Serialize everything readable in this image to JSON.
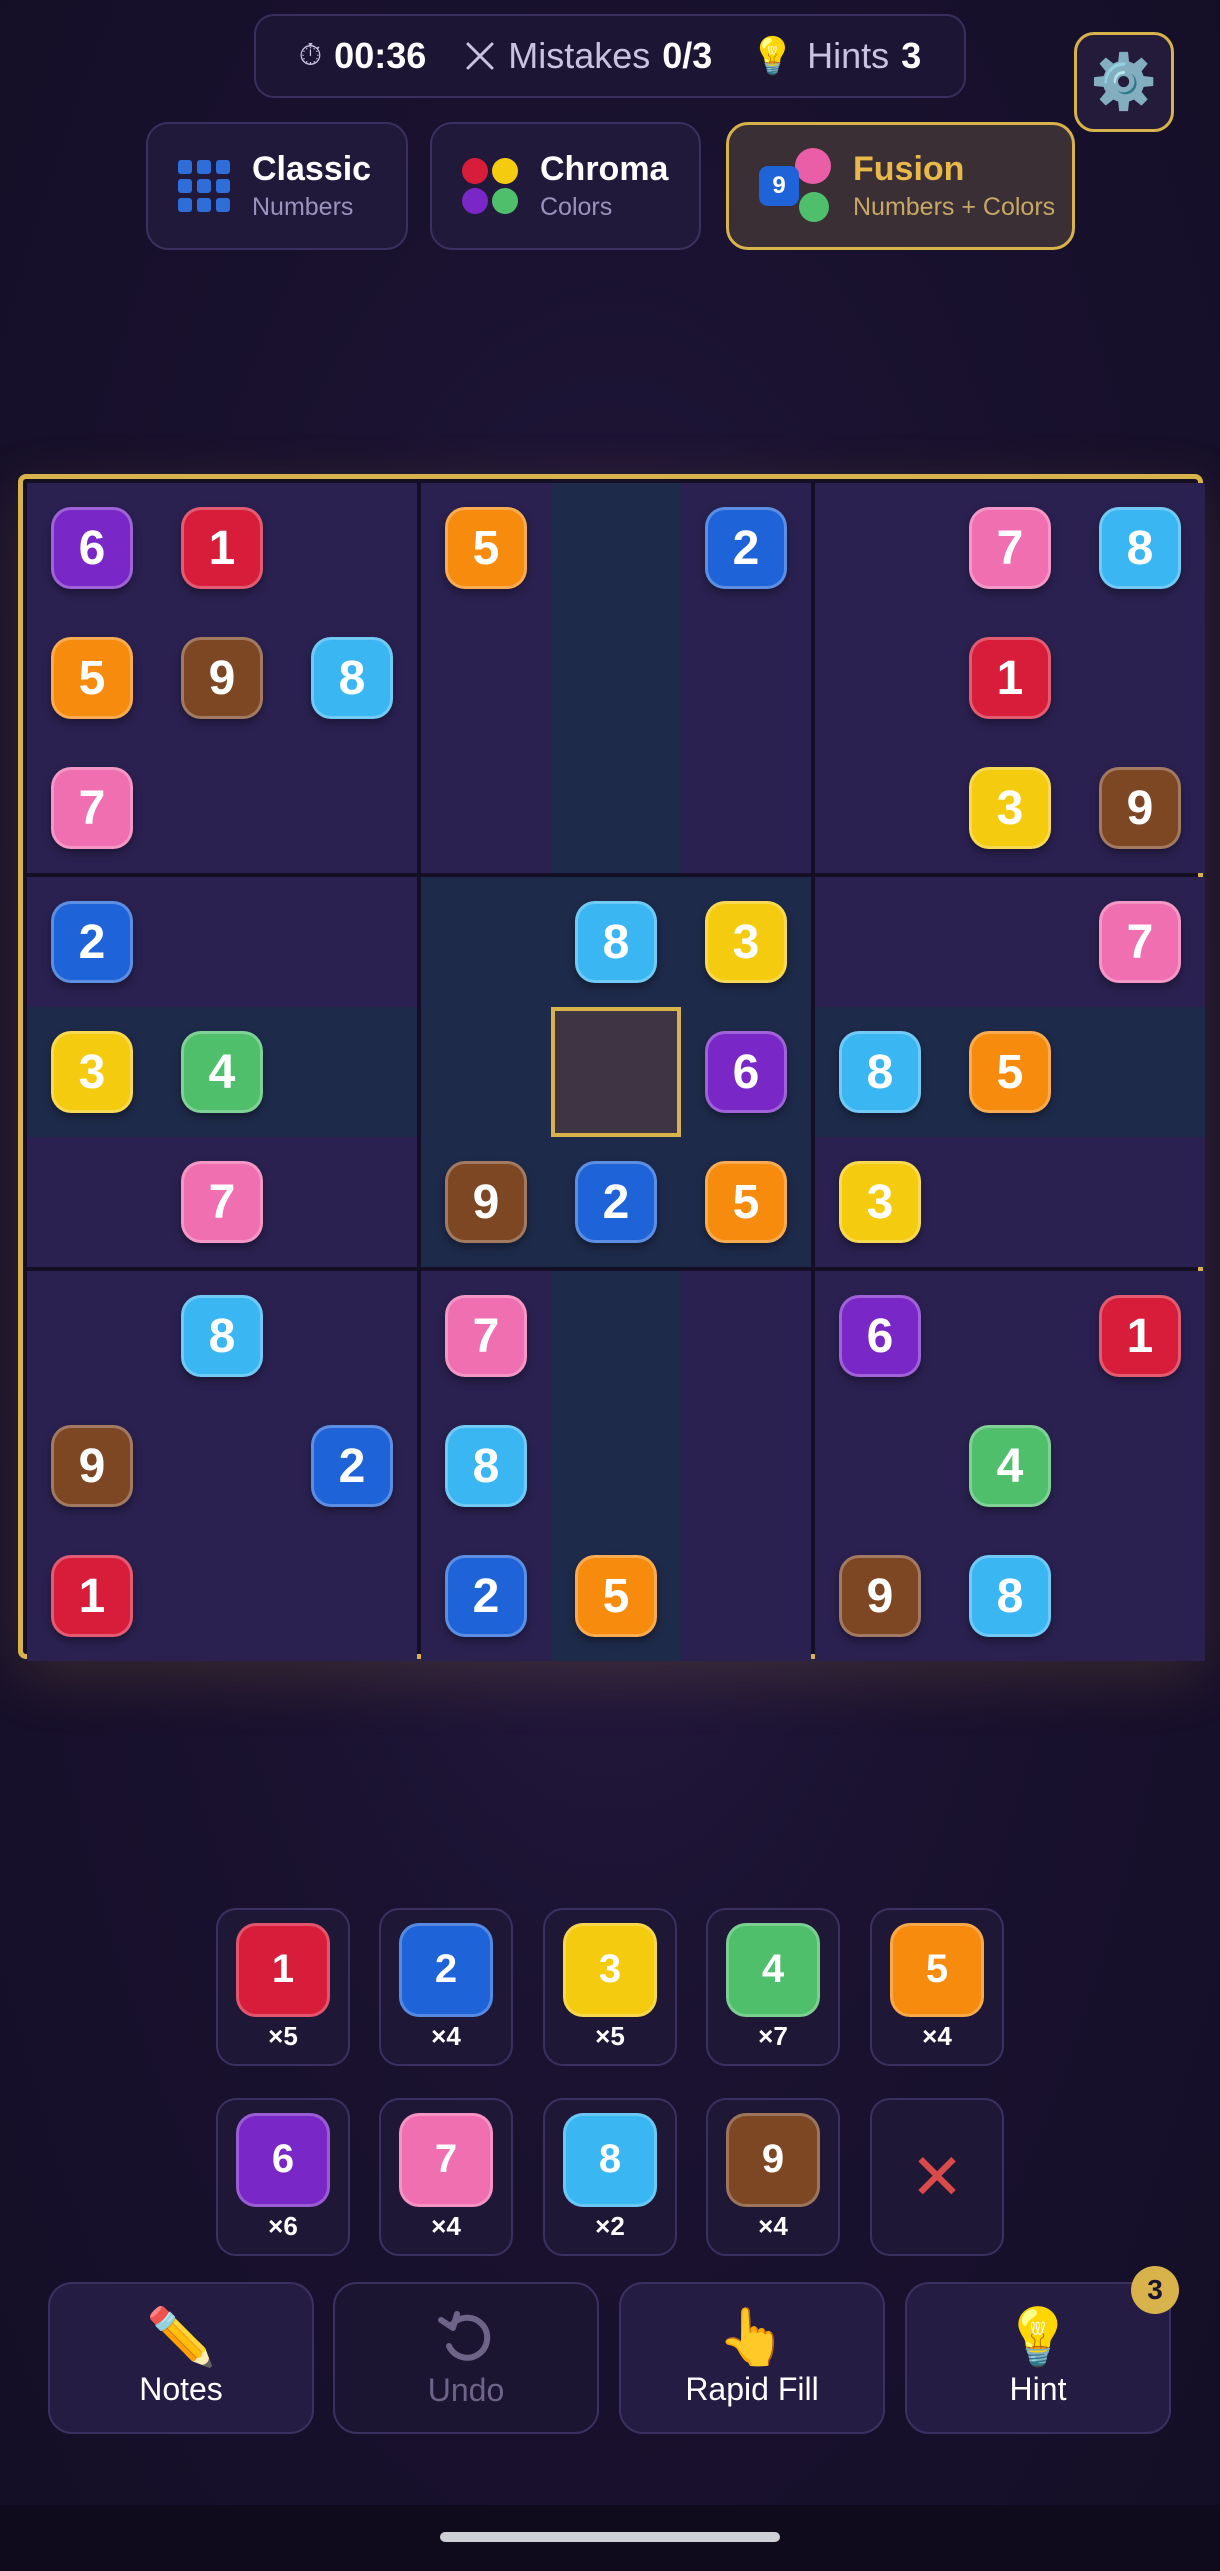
{
  "status": {
    "timer": "00:36",
    "mistakes_label": "Mistakes",
    "mistakes_value": "0/3",
    "hints_label": "Hints",
    "hints_value": "3"
  },
  "settings": {
    "icon": "gear-icon"
  },
  "modes": [
    {
      "title": "Classic",
      "subtitle": "Numbers",
      "active": false
    },
    {
      "title": "Chroma",
      "subtitle": "Colors",
      "active": false
    },
    {
      "title": "Fusion",
      "subtitle": "Numbers + Colors",
      "active": true,
      "badge": "9"
    }
  ],
  "palette": {
    "1": "#d81d3b",
    "2": "#1e63d8",
    "3": "#f5cb10",
    "4": "#4fbf6c",
    "5": "#f78b0e",
    "6": "#7a27c8",
    "7": "#f06fb0",
    "8": "#3ab6f2",
    "9": "#7d4724"
  },
  "board": {
    "grid": [
      [
        6,
        1,
        0,
        5,
        0,
        2,
        0,
        7,
        8
      ],
      [
        5,
        9,
        8,
        0,
        0,
        0,
        0,
        1,
        0
      ],
      [
        7,
        0,
        0,
        0,
        0,
        0,
        0,
        3,
        9
      ],
      [
        2,
        0,
        0,
        0,
        8,
        3,
        0,
        0,
        7
      ],
      [
        3,
        4,
        0,
        0,
        0,
        6,
        8,
        5,
        0
      ],
      [
        0,
        7,
        0,
        9,
        2,
        5,
        3,
        0,
        0
      ],
      [
        0,
        8,
        0,
        7,
        0,
        0,
        6,
        0,
        1
      ],
      [
        9,
        0,
        2,
        8,
        0,
        0,
        0,
        4,
        0
      ],
      [
        1,
        0,
        0,
        2,
        5,
        0,
        9,
        8,
        0
      ]
    ],
    "selected": [
      4,
      4
    ]
  },
  "pad": [
    {
      "digit": "1",
      "count": "×5"
    },
    {
      "digit": "2",
      "count": "×4"
    },
    {
      "digit": "3",
      "count": "×5"
    },
    {
      "digit": "4",
      "count": "×7"
    },
    {
      "digit": "5",
      "count": "×4"
    },
    {
      "digit": "6",
      "count": "×6"
    },
    {
      "digit": "7",
      "count": "×4"
    },
    {
      "digit": "8",
      "count": "×2"
    },
    {
      "digit": "9",
      "count": "×4"
    }
  ],
  "actions": {
    "notes": "Notes",
    "undo": "Undo",
    "rapid_fill": "Rapid Fill",
    "hint": "Hint",
    "hint_badge": "3"
  }
}
